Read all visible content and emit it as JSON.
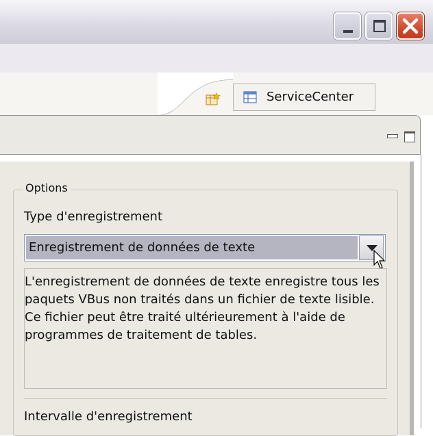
{
  "window": {
    "minimize_icon": "minimize-icon",
    "maximize_icon": "maximize-icon",
    "close_icon": "close-icon"
  },
  "perspective": {
    "open_perspective_icon": "open-perspective-icon",
    "tab_label": "ServiceCenter",
    "tab_icon": "table-icon"
  },
  "view": {
    "minimize_icon": "view-minimize-icon",
    "maximize_icon": "view-maximize-icon"
  },
  "options": {
    "group_title": "Options",
    "type_label": "Type d'enregistrement",
    "type_selected": "Enregistrement de données de texte",
    "description": "L'enregistrement de données de texte enregistre tous les paquets VBus non traités dans un fichier de texte lisible. Ce fichier peut être traité ultérieurement à l'aide de programmes de traitement de tables.",
    "interval_label": "Intervalle d'enregistrement"
  },
  "colors": {
    "close_button": "#cf4a2d",
    "selection": "#b5b4c1",
    "panel_bg": "#ece9e3"
  }
}
